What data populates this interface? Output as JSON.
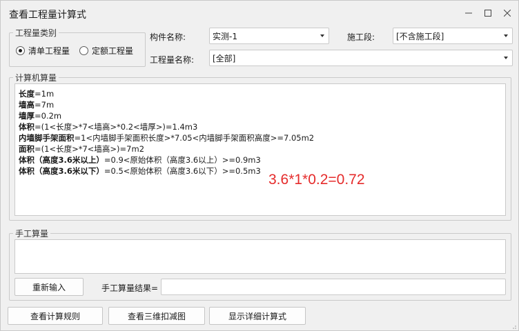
{
  "window": {
    "title": "查看工程量计算式",
    "minimize_icon": "minimize-icon",
    "maximize_icon": "maximize-icon",
    "close_icon": "close-icon"
  },
  "category": {
    "legend": "工程量类别",
    "options": [
      {
        "label": "清单工程量",
        "checked": true
      },
      {
        "label": "定额工程量",
        "checked": false
      }
    ]
  },
  "filters": {
    "component_label": "构件名称:",
    "component_value": "实测-1",
    "stage_label": "施工段:",
    "stage_value": "[不含施工段]",
    "quantity_label": "工程量名称:",
    "quantity_value": "[全部]"
  },
  "computer_calc": {
    "legend": "计算机算量",
    "lines": [
      {
        "bold": "长度",
        "rest": "=1m"
      },
      {
        "bold": "墙高",
        "rest": "=7m"
      },
      {
        "bold": "墙厚",
        "rest": "=0.2m"
      },
      {
        "bold": "体积",
        "rest": "=(1<长度>*7<墙高>*0.2<墙厚>)=1.4m3"
      },
      {
        "bold": "内墙脚手架面积",
        "rest": "=1<内墙脚手架面积长度>*7.05<内墙脚手架面积高度>=7.05m2"
      },
      {
        "bold": "面积",
        "rest": "=(1<长度>*7<墙高>)=7m2"
      },
      {
        "bold": "体积（高度3.6米以上）",
        "rest": "=0.9<原始体积（高度3.6以上）>=0.9m3"
      },
      {
        "bold": "体积（高度3.6米以下）",
        "rest": "=0.5<原始体积（高度3.6以下）>=0.5m3"
      }
    ],
    "annotation": "3.6*1*0.2=0.72",
    "annotation_color": "#e52b2b"
  },
  "manual_calc": {
    "legend": "手工算量",
    "reenter_button": "重新输入",
    "result_label": "手工算量结果="
  },
  "footer": {
    "view_rules_button": "查看计算规则",
    "view_3d_button": "查看三维扣减图",
    "show_detail_button": "显示详细计算式"
  }
}
